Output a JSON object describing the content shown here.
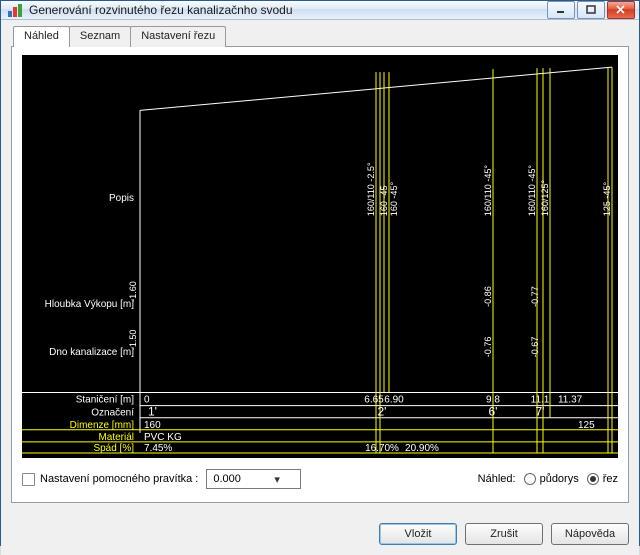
{
  "window": {
    "title": "Generování rozvinutého řezu kanalizačnho svodu"
  },
  "tabs": {
    "nahled": "Náhled",
    "seznam": "Seznam",
    "nastaveni": "Nastavení řezu"
  },
  "options": {
    "ruler_checkbox_label": "Nastavení pomocného pravítka :",
    "ruler_value": "0.000",
    "preview_label": "Náhled:",
    "radio_plan": "půdorys",
    "radio_section": "řez"
  },
  "buttons": {
    "insert": "Vložit",
    "cancel": "Zrušit",
    "help": "Nápověda"
  },
  "row_labels": {
    "popis": "Popis",
    "hloubka": "Hloubka Výkopu [m]",
    "dno": "Dno kanalizace [m]",
    "staniceni": "Staničení [m]",
    "oznaceni": "Označení",
    "dimenze": "Dimenze [mm]",
    "material": "Materiál",
    "spad": "Spád [%]"
  },
  "row_values": {
    "staniceni_0": "0",
    "hloubka_0": "-1.60",
    "dno_0": "-1.50",
    "oznaceni_1": "1'",
    "dimenze_1": "160",
    "material": "PVC KG",
    "spad_1": "7.45%",
    "oznaceni_2": "2'",
    "staniceni_2a": "6.65",
    "staniceni_2b": "6.90",
    "spad_2": "16.70%",
    "spad_3": "20.90%",
    "oznaceni_6": "6'",
    "staniceni_6": "9.8",
    "hloubka_6": "-0.86",
    "dno_6": "-0.76",
    "oznaceni_7": "7'",
    "staniceni_7": "11.1",
    "staniceni_8": "11.37",
    "hloubka_7": "-0.77",
    "dno_7": "-0.67",
    "dimenze_8": "125"
  },
  "popis_labels": {
    "p2a": "160/110 -2.5°",
    "p2b": "160 -45",
    "p2c": "160 -45°",
    "p6": "160/110 -45°",
    "p7a": "160/110 -45°",
    "p7b": "160/125°",
    "p8": "125 -45°"
  },
  "chart_data": {
    "type": "profile-section",
    "x_range_m": [
      0,
      12
    ],
    "stations": [
      {
        "id": "1'",
        "station_m": 0.0,
        "depth_m": -1.6,
        "invert_m": -1.5,
        "diameter_mm": 160,
        "slope_pct_to_next": 7.45,
        "popis": []
      },
      {
        "id": "2'",
        "station_m": 6.65,
        "depth_m": null,
        "invert_m": null,
        "diameter_mm": 160,
        "slope_pct_to_next": 16.7,
        "popis": [
          "160/110 -2.5°",
          "160 -45",
          "160 -45°"
        ]
      },
      {
        "id": "",
        "station_m": 6.9,
        "depth_m": null,
        "invert_m": null,
        "diameter_mm": 160,
        "slope_pct_to_next": 20.9,
        "popis": []
      },
      {
        "id": "6'",
        "station_m": 9.8,
        "depth_m": -0.86,
        "invert_m": -0.76,
        "diameter_mm": 160,
        "slope_pct_to_next": null,
        "popis": [
          "160/110 -45°"
        ]
      },
      {
        "id": "7'",
        "station_m": 11.1,
        "depth_m": -0.77,
        "invert_m": -0.67,
        "diameter_mm": 160,
        "slope_pct_to_next": null,
        "popis": [
          "160/110 -45°",
          "160/125°"
        ]
      },
      {
        "id": "",
        "station_m": 11.37,
        "depth_m": null,
        "invert_m": null,
        "diameter_mm": 125,
        "slope_pct_to_next": null,
        "popis": [
          "125 -45°"
        ]
      }
    ],
    "material": "PVC KG"
  }
}
